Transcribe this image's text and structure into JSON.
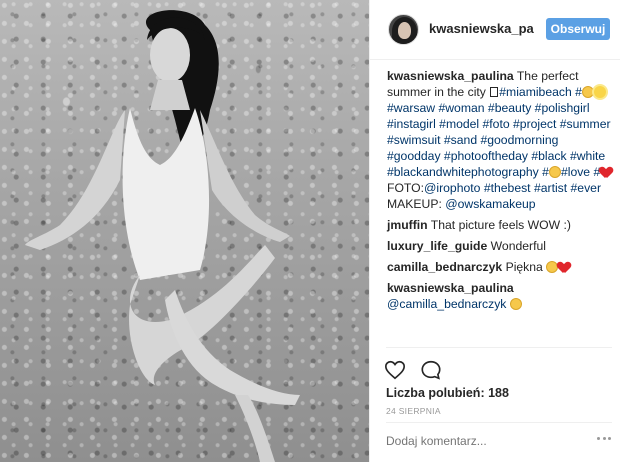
{
  "post": {
    "photo_alt": "",
    "username": "kwasniewska_paulina",
    "follow_label": "Obserwuj"
  },
  "caption": {
    "user": "kwasniewska_paulina",
    "text_1": "The perfect summer in the city",
    "tag_1": "#miamibeach",
    "tag_2": "#",
    "tag_3": "#warsaw #woman #beauty #polishgirl #instagirl #model #foto #project #summer #swimsuit #sand #goodmorning #goodday #photooftheday #black #white #blackandwhitephotography #",
    "tag_4": "#love #",
    "text_2": "FOTO:",
    "tag_5": "@irophoto #thebest #artist #ever",
    "text_3": "MAKEUP:",
    "tag_6": "@owskamakeup"
  },
  "comments": [
    {
      "user": "jmuffin",
      "text": "That picture feels WOW :)"
    },
    {
      "user": "luxury_life_guide",
      "text": "Wonderful"
    },
    {
      "user": "camilla_bednarczyk",
      "text": "Piękna"
    },
    {
      "user": "kwasniewska_paulina",
      "mention": "@camilla_bednarczyk"
    }
  ],
  "likes_label": "Liczba polubień: 188",
  "date": "24 SIERPNIA",
  "add_comment_placeholder": "Dodaj komentarz...",
  "icons": {
    "like": "heart-icon",
    "comment": "speech-bubble-icon",
    "more": "more-options-icon"
  },
  "colors": {
    "follow_button": "#5ba0e4",
    "link": "#003569",
    "heart": "#e0262c"
  }
}
